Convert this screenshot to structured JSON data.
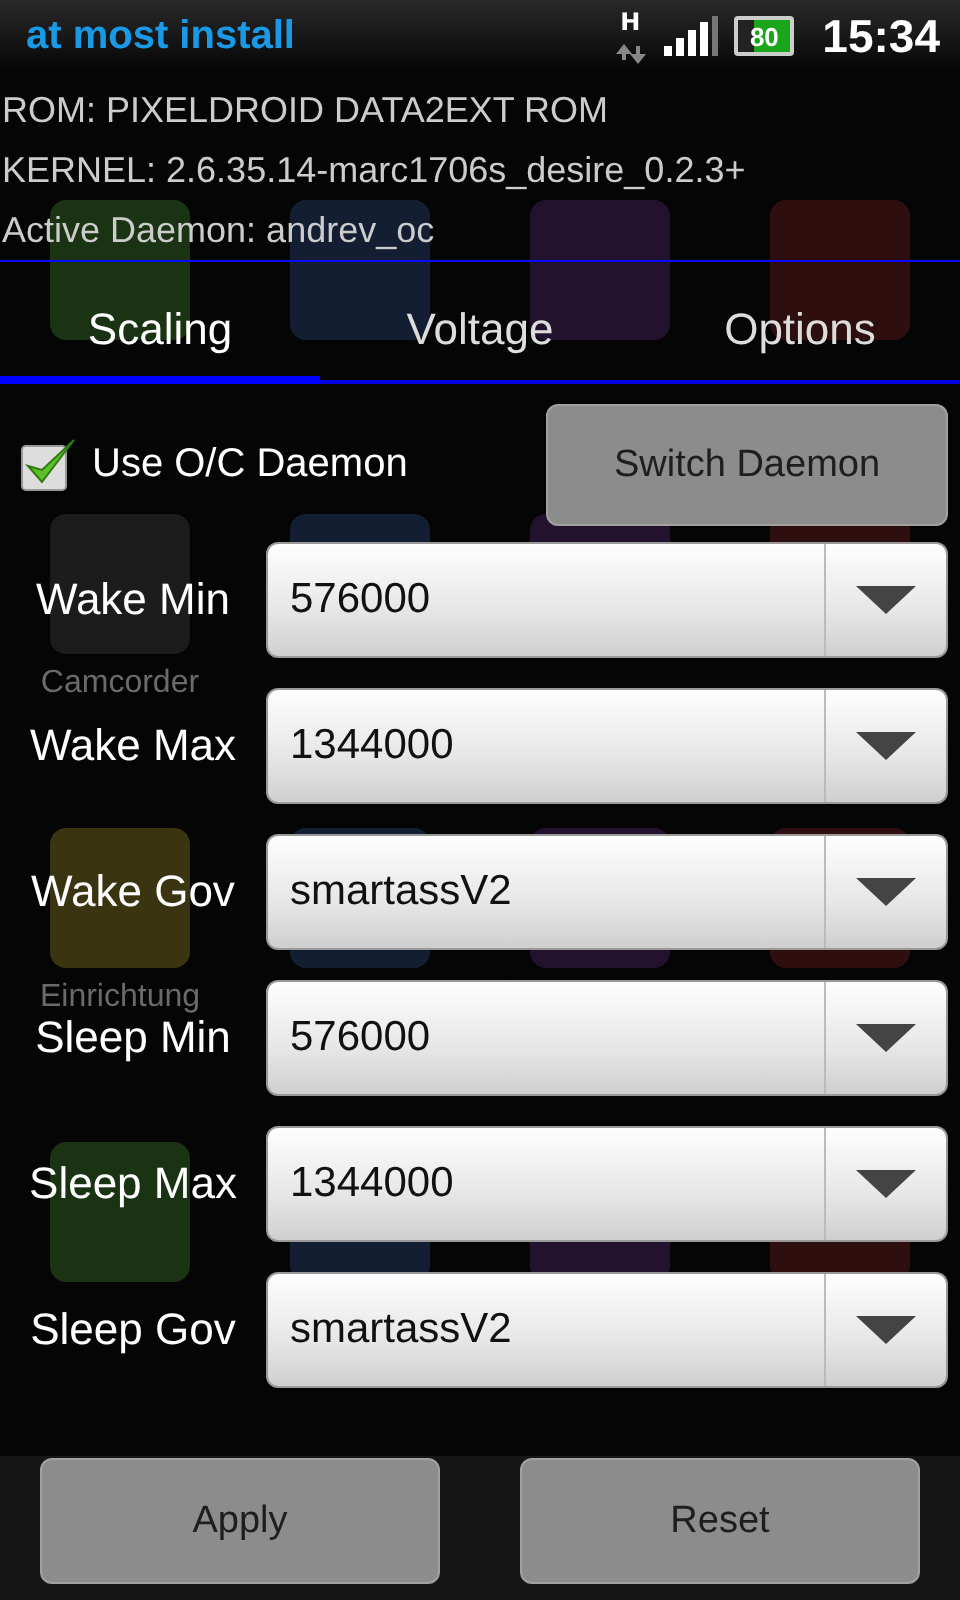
{
  "status_bar": {
    "title": "at most install",
    "network": "H",
    "battery": "80",
    "time": "15:34"
  },
  "background": {
    "apps": [
      {
        "kind": "icon"
      },
      {
        "kind": "icon"
      },
      {
        "kind": "icon"
      },
      {
        "kind": "icon"
      },
      {
        "kind": "icon",
        "label": "Camcorder"
      },
      {
        "kind": "icon"
      },
      {
        "kind": "icon"
      },
      {
        "kind": "icon"
      },
      {
        "kind": "icon",
        "label": "Einrichtung"
      },
      {
        "kind": "icon"
      },
      {
        "kind": "icon"
      },
      {
        "kind": "icon"
      },
      {
        "kind": "icon"
      },
      {
        "kind": "icon"
      },
      {
        "kind": "icon"
      },
      {
        "kind": "icon"
      }
    ]
  },
  "info": [
    "ROM: PIXELDROID DATA2EXT ROM",
    "KERNEL: 2.6.35.14-marc1706s_desire_0.2.3+",
    "Active Daemon: andrev_oc"
  ],
  "tabs": [
    {
      "label": "Scaling",
      "selected": true
    },
    {
      "label": "Voltage",
      "selected": false
    },
    {
      "label": "Options",
      "selected": false
    }
  ],
  "daemon": {
    "label": "Use O/C Daemon",
    "checked": true,
    "button": "Switch Daemon"
  },
  "settings": [
    {
      "label": "Wake Min",
      "value": "576000"
    },
    {
      "label": "Wake Max",
      "value": "1344000"
    },
    {
      "label": "Wake Gov",
      "value": "smartassV2"
    },
    {
      "label": "Sleep Min",
      "value": "576000"
    },
    {
      "label": "Sleep Max",
      "value": "1344000"
    },
    {
      "label": "Sleep Gov",
      "value": "smartassV2"
    }
  ],
  "buttons": [
    "Apply",
    "Reset"
  ]
}
